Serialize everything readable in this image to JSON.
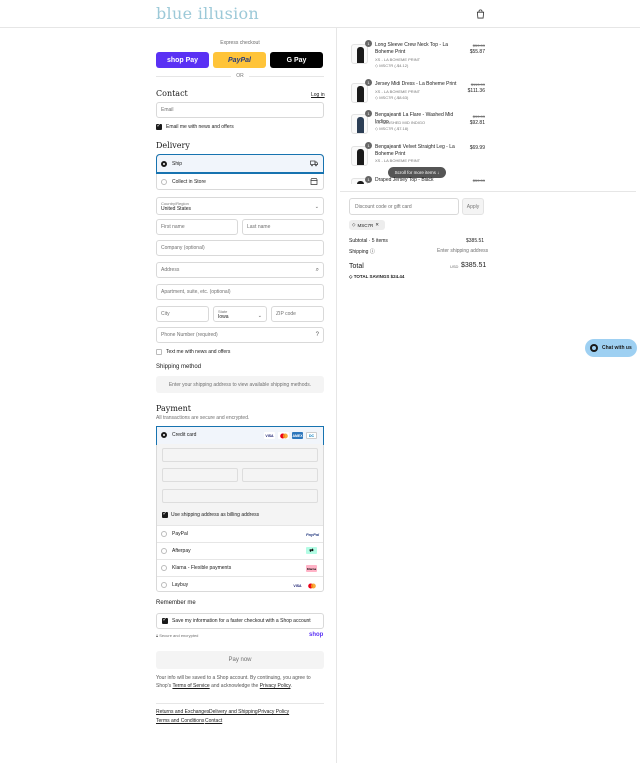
{
  "brand": {
    "name": "blue illusion",
    "logo_color": "#9cc9d8"
  },
  "express": {
    "title": "Express checkout",
    "buttons": [
      "shop Pay",
      "PayPal",
      "G Pay"
    ],
    "or": "OR"
  },
  "contact": {
    "title": "Contact",
    "login": "Log in",
    "email_placeholder": "Email",
    "news_label": "Email me with news and offers"
  },
  "delivery": {
    "title": "Delivery",
    "options": [
      {
        "label": "Ship",
        "selected": true,
        "icon": "truck-icon"
      },
      {
        "label": "Collect in Store",
        "selected": false,
        "icon": "store-icon"
      }
    ],
    "country_label": "Country/Region",
    "country_value": "United States",
    "first_name": "First name",
    "last_name": "Last name",
    "company": "Company (optional)",
    "address": "Address",
    "apartment": "Apartment, suite, etc. (optional)",
    "city": "City",
    "state_label": "State",
    "state_value": "Iowa",
    "zip": "ZIP code",
    "phone": "Phone Number (required)",
    "text_label": "Text me with news and offers"
  },
  "shipping_method": {
    "title": "Shipping method",
    "message": "Enter your shipping address to view available shipping methods."
  },
  "payment": {
    "title": "Payment",
    "subtitle": "All transactions are secure and encrypted.",
    "credit_card": "Credit card",
    "billing_label": "Use shipping address as billing address",
    "methods": [
      "PayPal",
      "Afterpay",
      "Klarna - Flexible payments",
      "Laybuy"
    ],
    "card_brands": [
      "VISA",
      "MC",
      "AMEX",
      "DC"
    ]
  },
  "remember": {
    "title": "Remember me",
    "save_label": "Save my information for a faster checkout with a Shop account",
    "secure": "Secure and encrypted",
    "shop": "shop"
  },
  "pay_now": "Pay now",
  "legal": {
    "line1": "Your info will be saved to a Shop account. By continuing, you agree to Shop's",
    "terms": "Terms of Service",
    "and": "and acknowledge the",
    "privacy": "Privacy Policy",
    "period": "."
  },
  "footer_links": [
    "Returns and Exchanges",
    "Delivery and Shipping",
    "Privacy Policy",
    "Terms and Conditions",
    "Contact"
  ],
  "order": {
    "items": [
      {
        "qty": "1",
        "name": "Long Sleeve Crew Neck Top - La Boheme Print",
        "variant": "XS - LA BOHEME PRINT",
        "discount": "MSC7R (-$4.12)",
        "old": "$59.99",
        "price": "$55.87"
      },
      {
        "qty": "1",
        "name": "Jersey Midi Dress - La Boheme Print",
        "variant": "XS - LA BOHEME PRINT",
        "discount": "MSC7R (-$8.63)",
        "old": "$119.99",
        "price": "$111.36"
      },
      {
        "qty": "1",
        "name": "Bengajeanti La Flare - Washed Mid Indigo",
        "variant": "XS - WASHED MID INDIGO",
        "discount": "MSC7R (-$7.18)",
        "old": "$99.99",
        "price": "$92.81"
      },
      {
        "qty": "1",
        "name": "Bengajeanti Velvet Straight Leg - La Boheme Print",
        "variant": "XS - LA BOHEME PRINT",
        "discount": "",
        "old": "",
        "price": "$69.99"
      },
      {
        "qty": "1",
        "name": "Draped Jersey Top - Black",
        "variant": "",
        "discount": "",
        "old": "$59.99",
        "price": ""
      }
    ],
    "scroll_hint": "Scroll for more items",
    "discount_placeholder": "Discount code or gift card",
    "apply": "Apply",
    "code": "MSC7R",
    "subtotal_label": "Subtotal · 5 items",
    "subtotal_value": "$385.51",
    "shipping_label": "Shipping",
    "shipping_value": "Enter shipping address",
    "total_label": "Total",
    "currency": "USD",
    "total_value": "$385.51",
    "savings_label": "TOTAL SAVINGS",
    "savings_value": "$24.44"
  },
  "chat": "Chat with us"
}
